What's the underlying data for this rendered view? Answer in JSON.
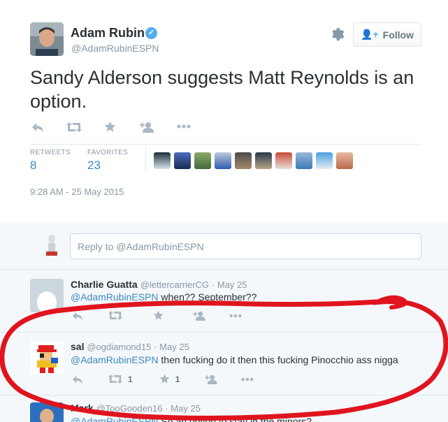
{
  "tweet": {
    "author_name": "Adam Rubin",
    "author_handle": "@AdamRubinESPN",
    "follow_label": "Follow",
    "text": "Sandy Alderson suggests Matt Reynolds is an option.",
    "retweets_label": "RETWEETS",
    "retweets_count": "8",
    "favorites_label": "FAVORITES",
    "favorites_count": "23",
    "timestamp": "9:28 AM - 25 May 2015",
    "icons": [
      "reply-icon",
      "retweet-icon",
      "favorite-icon",
      "follow-icon",
      "more-icon"
    ]
  },
  "reply_box": {
    "placeholder": "Reply to @AdamRubinESPN"
  },
  "replies": [
    {
      "name": "Charlie Guatta",
      "handle": "@lettercarrierCG",
      "date": "· May 25",
      "mention": "@AdamRubinESPN",
      "text": " when?? September??",
      "retweet_count": "",
      "favorite_count": ""
    },
    {
      "name": "sal",
      "handle": "@ogdiamond15",
      "date": "· May 25",
      "mention": "@AdamRubinESPN",
      "text": " then fucking do it then this fucking Pinocchio ass nigga",
      "retweet_count": "1",
      "favorite_count": "1"
    },
    {
      "name": "Mark",
      "handle": "@TooGooden16",
      "date": "· May 25",
      "mention": "@AdamRubinESPN",
      "text": " So an option to stay in the minors?",
      "retweet_count": "",
      "favorite_count": ""
    }
  ],
  "colors": {
    "link": "#3b88c3",
    "muted": "#8899a6",
    "annotation_red": "#e0141e"
  }
}
